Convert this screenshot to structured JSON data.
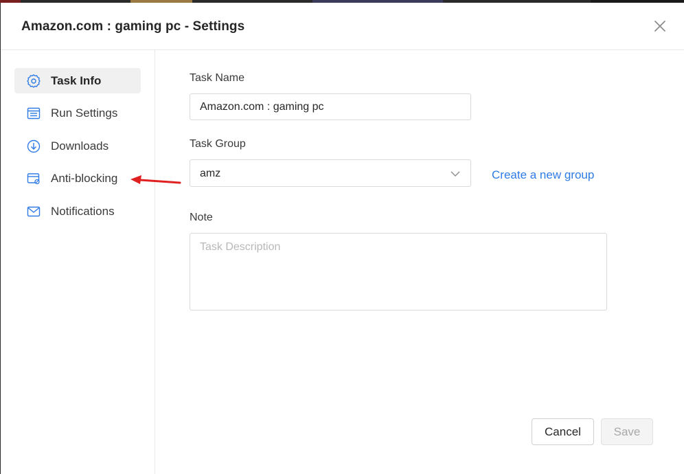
{
  "dialog": {
    "title": "Amazon.com : gaming pc - Settings"
  },
  "sidebar": {
    "items": [
      {
        "label": "Task Info",
        "icon": "gear-icon",
        "active": true
      },
      {
        "label": "Run Settings",
        "icon": "list-icon",
        "active": false
      },
      {
        "label": "Downloads",
        "icon": "download-icon",
        "active": false
      },
      {
        "label": "Anti-blocking",
        "icon": "anti-blocking-icon",
        "active": false
      },
      {
        "label": "Notifications",
        "icon": "mail-icon",
        "active": false
      }
    ]
  },
  "form": {
    "task_name_label": "Task Name",
    "task_name_value": "Amazon.com : gaming pc",
    "task_group_label": "Task Group",
    "task_group_value": "amz",
    "create_group_link": "Create a new group",
    "note_label": "Note",
    "note_placeholder": "Task Description"
  },
  "footer": {
    "cancel_label": "Cancel",
    "save_label": "Save"
  },
  "colors": {
    "accent": "#2f7be5",
    "annotation_arrow": "#e02020"
  }
}
